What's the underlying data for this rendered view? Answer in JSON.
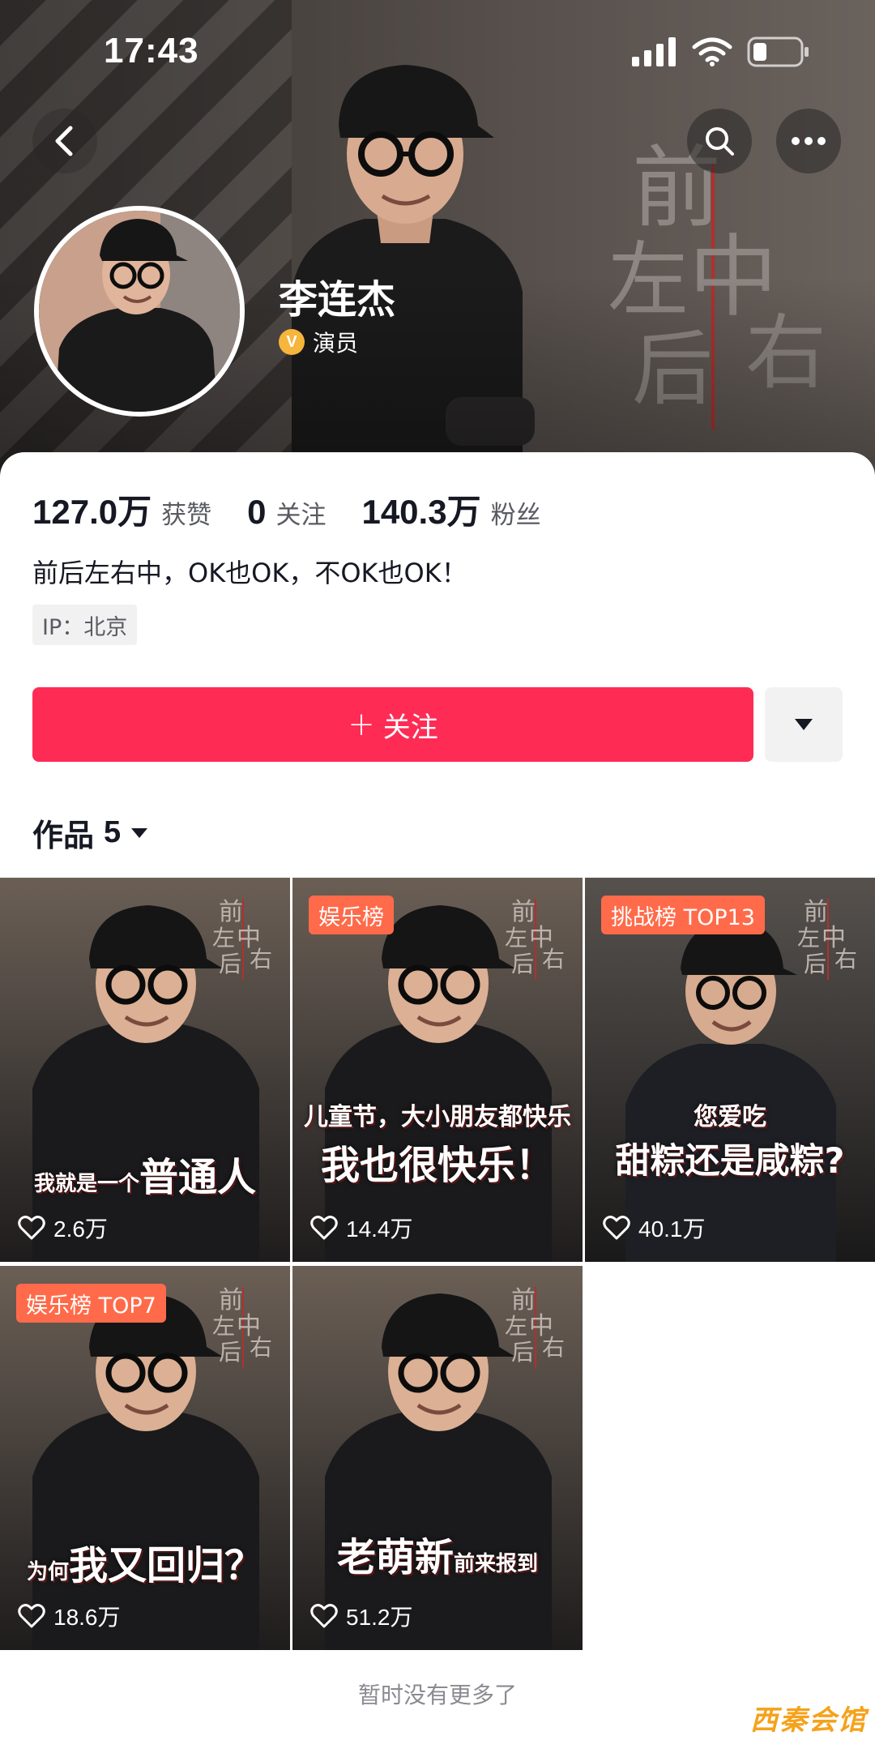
{
  "status_bar": {
    "time": "17:43"
  },
  "cover": {
    "logo_chars": [
      "前",
      "左",
      "中",
      "后",
      "右"
    ]
  },
  "profile": {
    "name": "李连杰",
    "verify_badge": "V",
    "verify_label": "演员",
    "bio": "前后左右中，OK也OK，不OK也OK！",
    "ip": "IP：北京"
  },
  "stats": [
    {
      "value": "127.0万",
      "label": "获赞"
    },
    {
      "value": "0",
      "label": "关注"
    },
    {
      "value": "140.3万",
      "label": "粉丝"
    }
  ],
  "follow_button": {
    "icon": "+",
    "label": "关注"
  },
  "works_tab": {
    "label": "作品",
    "count": "5"
  },
  "videos": [
    {
      "badge": "",
      "caption_small": "我就是一个",
      "caption_big": "普通人",
      "caption_line1": "",
      "likes": "2.6万"
    },
    {
      "badge": "娱乐榜",
      "caption_small": "",
      "caption_big": "我也很快乐！",
      "caption_line1": "儿童节，大小朋友都快乐",
      "likes": "14.4万"
    },
    {
      "badge": "挑战榜 TOP13",
      "caption_small": "",
      "caption_big": "甜粽还是咸粽?",
      "caption_line1": "您爱吃",
      "likes": "40.1万"
    },
    {
      "badge": "娱乐榜 TOP7",
      "caption_small": "为何",
      "caption_big": "我又回归？",
      "caption_line1": "",
      "likes": "18.6万"
    },
    {
      "badge": "",
      "caption_small": "前来报到",
      "caption_big": "老萌新",
      "caption_line1": "",
      "likes": "51.2万"
    }
  ],
  "footer": {
    "note": "暂时没有更多了",
    "watermark": "西秦会馆"
  },
  "colors": {
    "follow": "#fe2c55",
    "badge": "#ff6b4a",
    "verify": "#f6b53b"
  }
}
